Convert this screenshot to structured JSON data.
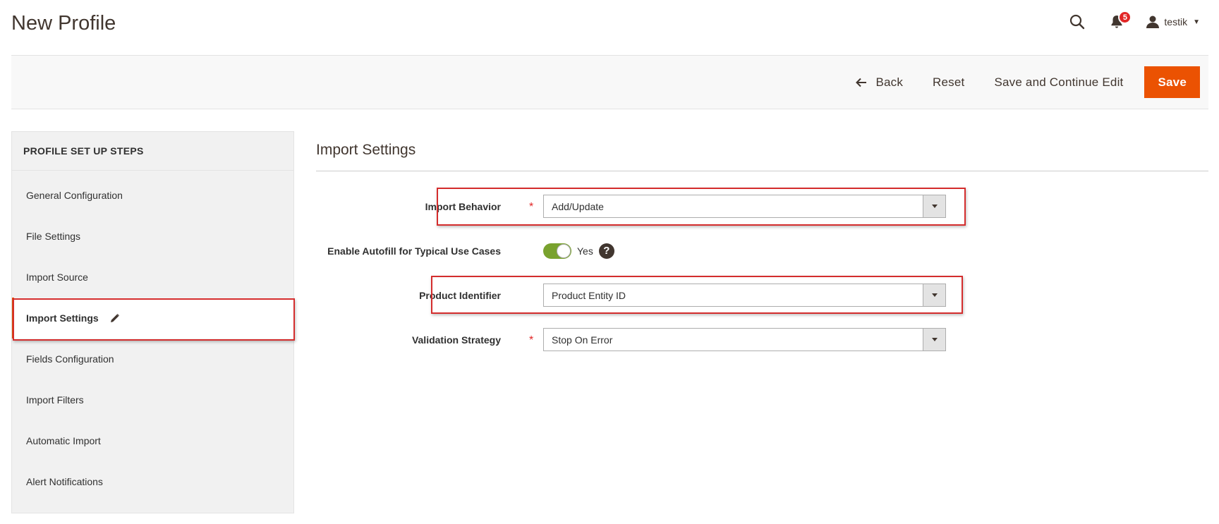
{
  "header": {
    "title": "New Profile",
    "notification_count": "5",
    "user_name": "testik"
  },
  "actions": {
    "back_label": "Back",
    "reset_label": "Reset",
    "save_continue_label": "Save and Continue Edit",
    "save_label": "Save"
  },
  "sidebar": {
    "title": "PROFILE SET UP STEPS",
    "items": [
      {
        "label": "General Configuration"
      },
      {
        "label": "File Settings"
      },
      {
        "label": "Import Source"
      },
      {
        "label": "Import Settings",
        "active": true
      },
      {
        "label": "Fields Configuration"
      },
      {
        "label": "Import Filters"
      },
      {
        "label": "Automatic Import"
      },
      {
        "label": "Alert Notifications"
      }
    ]
  },
  "main": {
    "section_title": "Import Settings",
    "fields": {
      "import_behavior": {
        "label": "Import Behavior",
        "value": "Add/Update",
        "required": true
      },
      "autofill": {
        "label": "Enable Autofill for Typical Use Cases",
        "value": "Yes",
        "enabled": true
      },
      "product_identifier": {
        "label": "Product Identifier",
        "value": "Product Entity ID"
      },
      "validation_strategy": {
        "label": "Validation Strategy",
        "value": "Stop On Error",
        "required": true
      }
    }
  },
  "colors": {
    "accent": "#eb5202",
    "highlight": "#d42d2d",
    "toggle_on": "#79a22e",
    "badge": "#e22626"
  },
  "icons": [
    "search-icon",
    "bell-icon",
    "user-icon",
    "chevron-down-icon",
    "back-arrow-icon",
    "pencil-icon",
    "question-icon",
    "dropdown-arrow-icon"
  ]
}
